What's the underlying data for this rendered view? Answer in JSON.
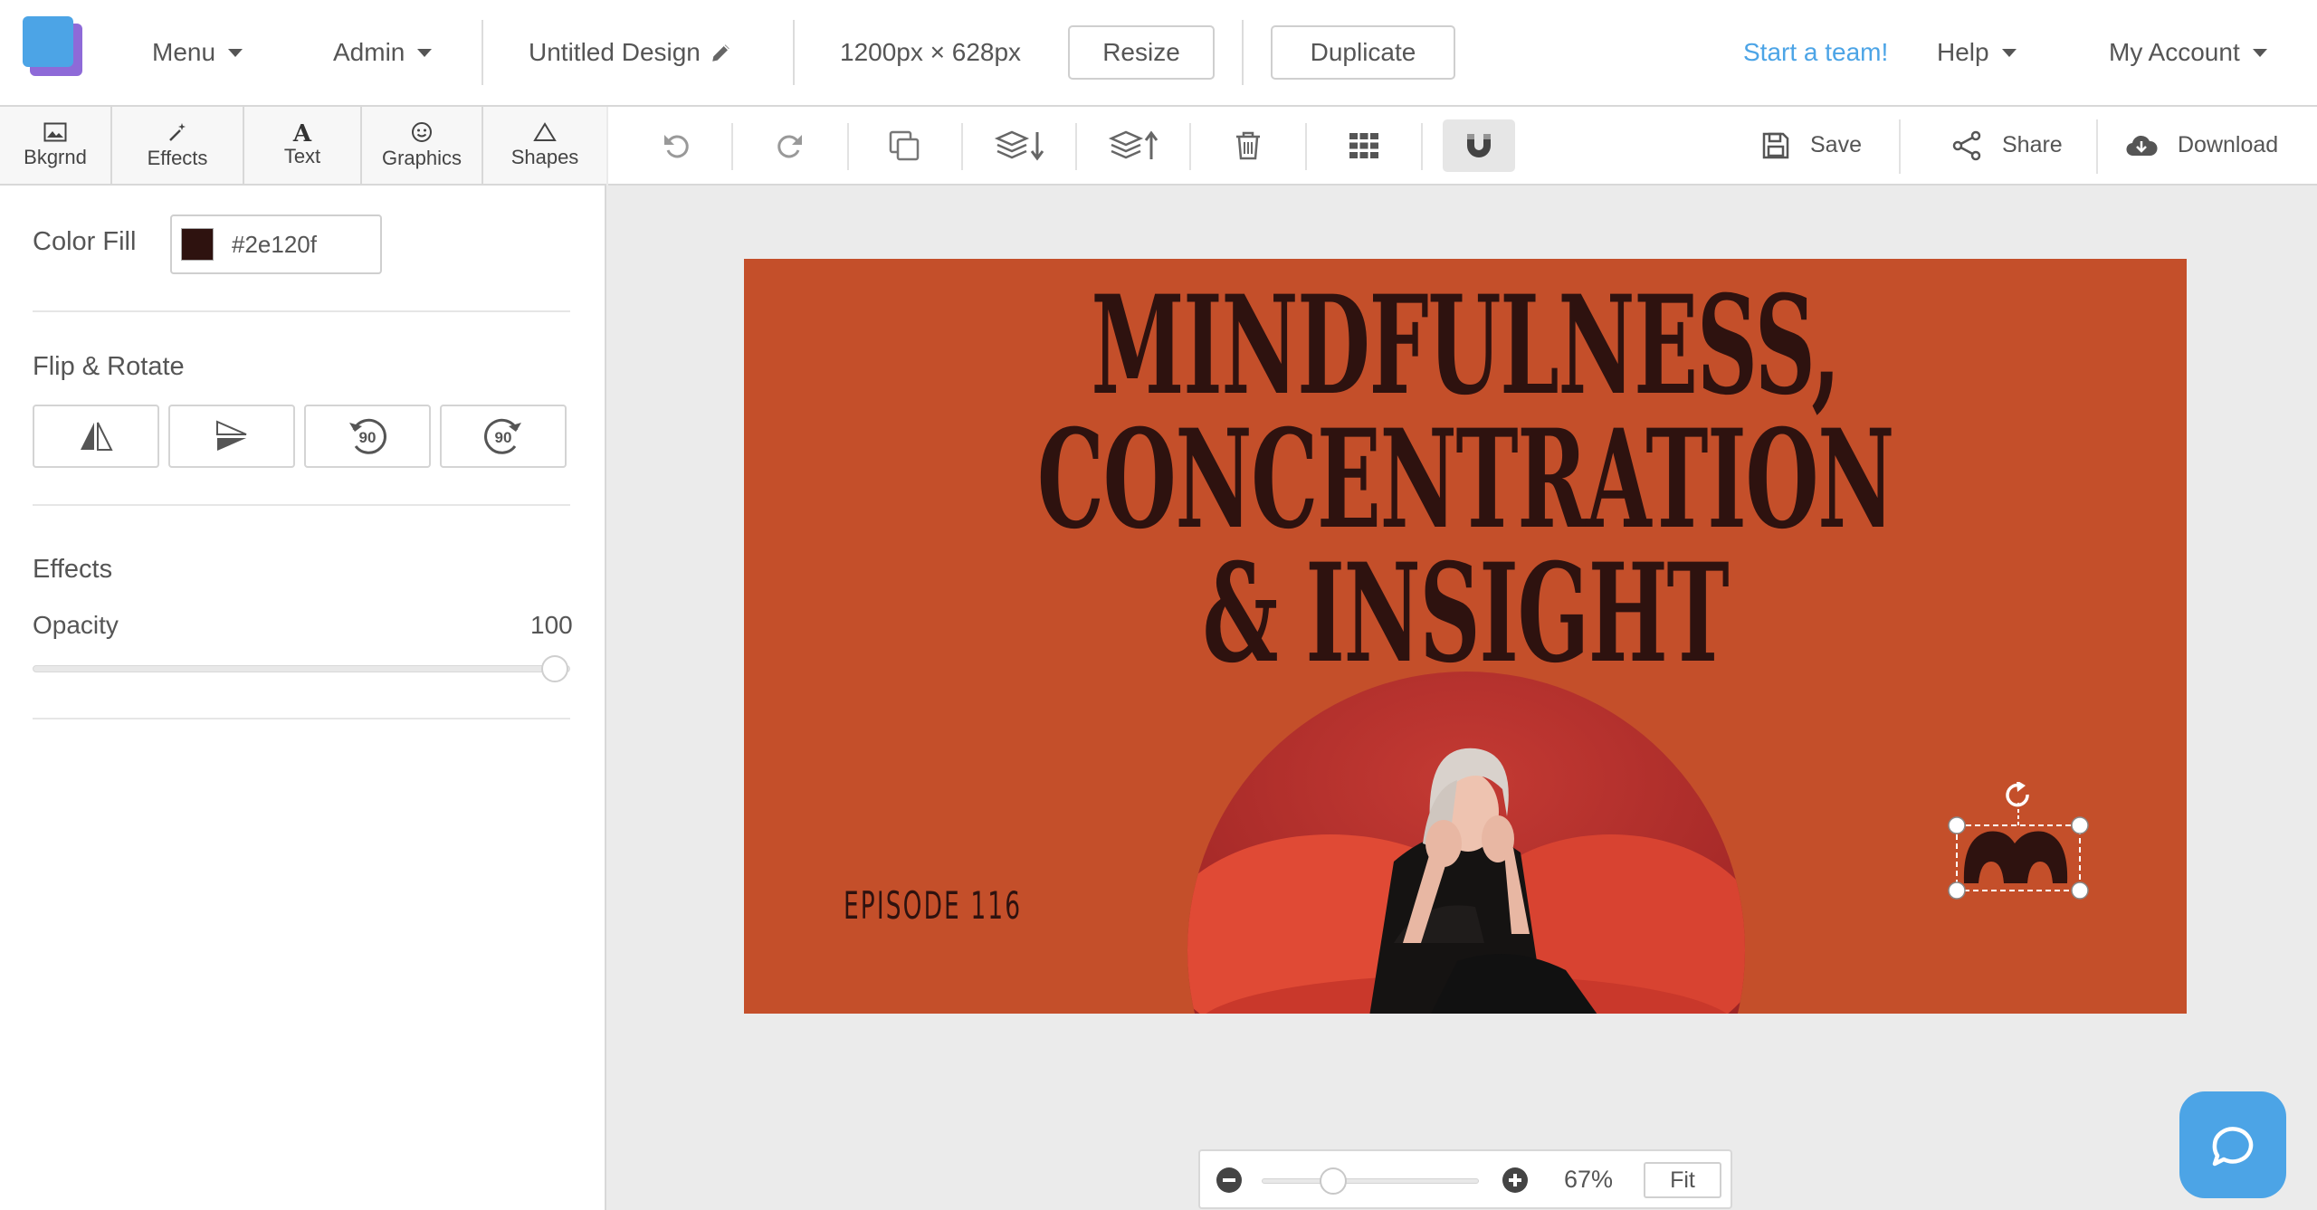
{
  "topbar": {
    "menu_label": "Menu",
    "admin_label": "Admin",
    "design_title": "Untitled Design",
    "dimensions": "1200px × 628px",
    "resize_label": "Resize",
    "duplicate_label": "Duplicate",
    "start_team_label": "Start a team!",
    "help_label": "Help",
    "account_label": "My Account"
  },
  "tabs": [
    {
      "label": "Bkgrnd",
      "icon": "image-icon"
    },
    {
      "label": "Effects",
      "icon": "magic-wand-icon"
    },
    {
      "label": "Text",
      "icon": "text-icon"
    },
    {
      "label": "Graphics",
      "icon": "smiley-icon"
    },
    {
      "label": "Shapes",
      "icon": "triangle-icon"
    }
  ],
  "panel": {
    "color_fill_label": "Color Fill",
    "color_fill_value": "#2e120f",
    "flip_rotate_label": "Flip & Rotate",
    "rotate_left_text": "90",
    "rotate_right_text": "90",
    "effects_label": "Effects",
    "opacity_label": "Opacity",
    "opacity_value": "100"
  },
  "toolbar": {
    "save_label": "Save",
    "share_label": "Share",
    "download_label": "Download"
  },
  "canvas": {
    "background_color": "#c44f2a",
    "headline_line1": "MINDFULNESS,",
    "headline_line2": "CONCENTRATION",
    "headline_line3": "& INSIGHT",
    "episode_label": "EPISODE 116"
  },
  "zoom": {
    "level": "67%",
    "fit_label": "Fit"
  },
  "colors": {
    "accent": "#4ca4e6",
    "link": "#4ca4e6",
    "fill": "#2e120f"
  }
}
